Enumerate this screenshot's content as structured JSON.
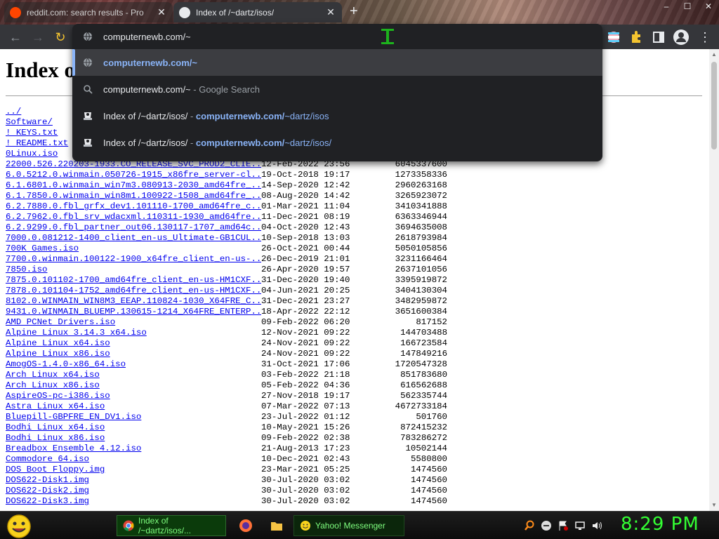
{
  "browser": {
    "tabs": [
      {
        "title": "reddit.com: search results - Pro",
        "active": false
      },
      {
        "title": "Index of /~dartz/isos/",
        "active": true
      }
    ],
    "new_tab_label": "+",
    "window_controls": [
      "–",
      "☐",
      "✕"
    ],
    "colors": {
      "accent_link": "#8ab4f8",
      "toolbar": "#35363a",
      "omnibox": "#202124"
    }
  },
  "omnibox": {
    "input_text": "computernewb.com/~",
    "suggestions": [
      {
        "icon": "globe-icon",
        "parts": [
          {
            "text": "computernewb.com/~",
            "style": "link bold"
          }
        ]
      },
      {
        "icon": "search-icon",
        "parts": [
          {
            "text": "computernewb.com/~",
            "style": ""
          },
          {
            "text": " - Google Search",
            "style": "dim"
          }
        ]
      },
      {
        "icon": "history-favicon-icon",
        "parts": [
          {
            "text": "Index of /~dartz/isos/",
            "style": ""
          },
          {
            "text": " - ",
            "style": "dim"
          },
          {
            "text": "computernewb.com/",
            "style": "link bold"
          },
          {
            "text": "~dartz/isos",
            "style": "link"
          }
        ]
      },
      {
        "icon": "history-favicon-icon",
        "parts": [
          {
            "text": "Index of /~dartz/isos/",
            "style": ""
          },
          {
            "text": " - ",
            "style": "dim"
          },
          {
            "text": "computernewb.com/",
            "style": "link bold"
          },
          {
            "text": "~dartz/isos/",
            "style": "link"
          }
        ]
      }
    ]
  },
  "page": {
    "heading": "Index of /~dartz/isos/",
    "entries": [
      {
        "name": "../",
        "date": "",
        "size": ""
      },
      {
        "name": "Software/",
        "date": "",
        "size": ""
      },
      {
        "name": "! KEYS.txt",
        "date": "",
        "size": ""
      },
      {
        "name": "! README.txt",
        "date": "",
        "size": ""
      },
      {
        "name": "0Linux.iso",
        "date": "",
        "size": ""
      },
      {
        "name": "22000.526.220203-1933.CO_RELEASE_SVC_PROD2_CLIE..>",
        "date": "12-Feb-2022 23:56",
        "size": "6045337600"
      },
      {
        "name": "6.0.5212.0.winmain.050726-1915_x86fre_server-cl..>",
        "date": "19-Oct-2018 19:17",
        "size": "1273358336"
      },
      {
        "name": "6.1.6801.0.winmain_win7m3.080913-2030_amd64fre_..>",
        "date": "14-Sep-2020 12:42",
        "size": "2960263168"
      },
      {
        "name": "6.1.7850.0.winmain_win8m1.100922-1508_amd64fre_..>",
        "date": "08-Aug-2020 14:42",
        "size": "3265923072"
      },
      {
        "name": "6.2.7880.0.fbl_grfx_dev1.101110-1700_amd64fre_c..>",
        "date": "01-Mar-2021 11:04",
        "size": "3410341888"
      },
      {
        "name": "6.2.7962.0.fbl_srv_wdacxml.110311-1930_amd64fre..>",
        "date": "11-Dec-2021 08:19",
        "size": "6363346944"
      },
      {
        "name": "6.2.9299.0.fbl_partner_out06.130117-1707_amd64c..>",
        "date": "04-Oct-2020 12:43",
        "size": "3694635008"
      },
      {
        "name": "7000.0.081212-1400_client_en-us_Ultimate-GB1CUL..>",
        "date": "10-Sep-2018 13:03",
        "size": "2618793984"
      },
      {
        "name": "700K Games.iso",
        "date": "26-Oct-2021 00:44",
        "size": "5050105856"
      },
      {
        "name": "7700.0.winmain.100122-1900_x64fre_client_en-us-..>",
        "date": "26-Dec-2019 21:01",
        "size": "3231166464"
      },
      {
        "name": "7850.iso",
        "date": "26-Apr-2020 19:57",
        "size": "2637101056"
      },
      {
        "name": "7875.0.101102-1700_amd64fre_client_en-us-HM1CXF..>",
        "date": "31-Dec-2020 19:40",
        "size": "3395919872"
      },
      {
        "name": "7878.0.101104-1752_amd64fre_client_en-us-HM1CXF..>",
        "date": "04-Jun-2021 20:25",
        "size": "3404130304"
      },
      {
        "name": "8102.0.WINMAIN_WIN8M3_EEAP.110824-1030_X64FRE_C..>",
        "date": "31-Dec-2021 23:27",
        "size": "3482959872"
      },
      {
        "name": "9431.0.WINMAIN_BLUEMP.130615-1214_X64FRE_ENTERP..>",
        "date": "18-Apr-2022 22:12",
        "size": "3651600384"
      },
      {
        "name": "AMD PCNet Drivers.iso",
        "date": "09-Feb-2022 06:20",
        "size": "817152"
      },
      {
        "name": "Alpine Linux 3.14.3 x64.iso",
        "date": "12-Nov-2021 09:22",
        "size": "144703488"
      },
      {
        "name": "Alpine Linux x64.iso",
        "date": "24-Nov-2021 09:22",
        "size": "166723584"
      },
      {
        "name": "Alpine Linux x86.iso",
        "date": "24-Nov-2021 09:22",
        "size": "147849216"
      },
      {
        "name": "AmogOS-1.4.0-x86_64.iso",
        "date": "31-Oct-2021 17:06",
        "size": "1720547328"
      },
      {
        "name": "Arch Linux x64.iso",
        "date": "03-Feb-2022 21:18",
        "size": "851783680"
      },
      {
        "name": "Arch Linux x86.iso",
        "date": "05-Feb-2022 04:36",
        "size": "616562688"
      },
      {
        "name": "AspireOS-pc-i386.iso",
        "date": "27-Nov-2018 19:17",
        "size": "562335744"
      },
      {
        "name": "Astra Linux x64.iso",
        "date": "07-Mar-2022 07:13",
        "size": "4672733184"
      },
      {
        "name": "Bluepill-GBPFRE_EN_DV1.iso",
        "date": "23-Jul-2022 01:12",
        "size": "501760"
      },
      {
        "name": "Bodhi Linux x64.iso",
        "date": "10-May-2021 15:26",
        "size": "872415232"
      },
      {
        "name": "Bodhi Linux x86.iso",
        "date": "09-Feb-2022 02:38",
        "size": "783286272"
      },
      {
        "name": "Breadbox Ensemble 4.12.iso",
        "date": "21-Aug-2013 17:23",
        "size": "10502144"
      },
      {
        "name": "Commodore 64.iso",
        "date": "10-Dec-2021 02:43",
        "size": "5580800"
      },
      {
        "name": "DOS Boot Floppy.img",
        "date": "23-Mar-2021 05:25",
        "size": "1474560"
      },
      {
        "name": "DOS622-Disk1.img",
        "date": "30-Jul-2020 03:02",
        "size": "1474560"
      },
      {
        "name": "DOS622-Disk2.img",
        "date": "30-Jul-2020 03:02",
        "size": "1474560"
      },
      {
        "name": "DOS622-Disk3.img",
        "date": "30-Jul-2020 03:02",
        "size": "1474560"
      }
    ]
  },
  "taskbar": {
    "buttons": [
      {
        "label": "Index of /~dartz/isos/..."
      },
      {
        "label": "Yahoo! Messenger"
      }
    ],
    "clock": "8:29 PM"
  }
}
